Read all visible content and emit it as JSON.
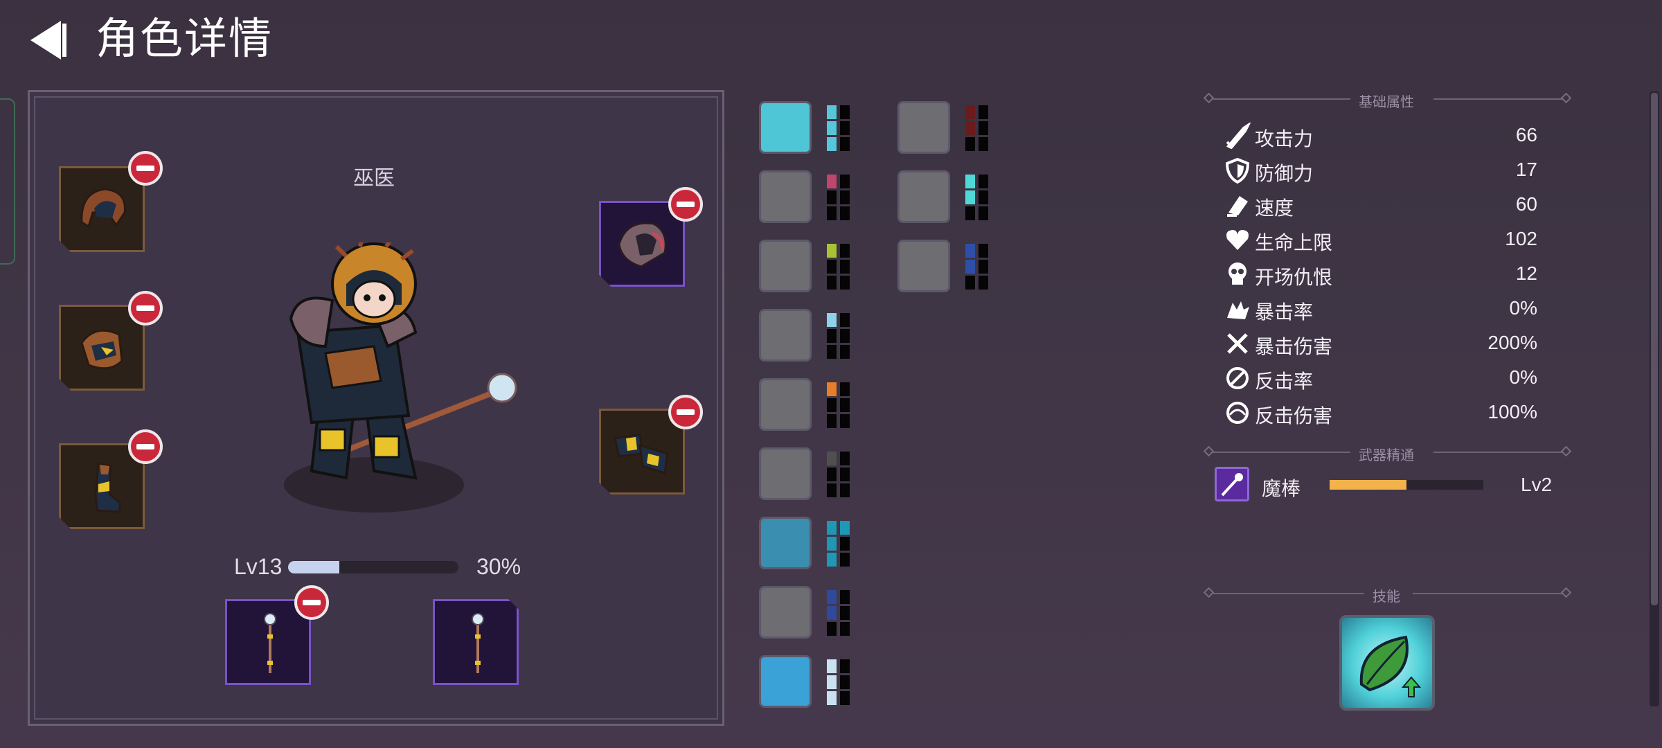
{
  "header": {
    "title": "角色详情"
  },
  "character": {
    "name": "巫医",
    "level_label": "Lv13",
    "level_progress": 0.3,
    "level_percent": "30%"
  },
  "skills_grid": {
    "column1": [
      {
        "icon": "warrior-leap-icon",
        "pips": [
          "#58c6da",
          "#000000",
          "#58c6da",
          "#000000",
          "#58c6da",
          "#000000"
        ],
        "colored": 3,
        "color": "#58c6da"
      },
      {
        "icon": "claw-slash-icon",
        "colored": 1,
        "color": "#c0466b"
      },
      {
        "icon": "helmet-icon",
        "colored": 1,
        "color": "#a8c232"
      },
      {
        "icon": "goblin-icon",
        "colored": 1,
        "color": "#8fd3ea"
      },
      {
        "icon": "magic-hand-icon",
        "colored": 1,
        "color": "#e67e2a"
      },
      {
        "icon": "lightning-orb-icon",
        "colored": 1,
        "color": "#505050"
      },
      {
        "icon": "armored-bird-icon",
        "colored": 4,
        "color": "#1f98b5"
      },
      {
        "icon": "hooded-figures-icon",
        "colored": 2,
        "color": "#2f4a9a"
      },
      {
        "icon": "golden-wings-icon",
        "colored": 3,
        "color": "#c8e2f0"
      }
    ],
    "column2": [
      {
        "icon": "monster-face-icon",
        "colored": 2,
        "color": "#6a1b1b"
      },
      {
        "icon": "ghost-shape-icon",
        "colored": 2,
        "color": "#4fd8d8"
      },
      {
        "icon": "tree-spirit-icon",
        "colored": 2,
        "color": "#2e4fa8"
      }
    ]
  },
  "stats": {
    "section_title": "基础属性",
    "items": [
      {
        "icon": "sword-icon",
        "label": "攻击力",
        "value": "66"
      },
      {
        "icon": "shield-icon",
        "label": "防御力",
        "value": "17"
      },
      {
        "icon": "boot-icon",
        "label": "速度",
        "value": "60"
      },
      {
        "icon": "heart-icon",
        "label": "生命上限",
        "value": "102"
      },
      {
        "icon": "skull-icon",
        "label": "开场仇恨",
        "value": "12"
      },
      {
        "icon": "crit-burst-icon",
        "label": "暴击率",
        "value": "0%"
      },
      {
        "icon": "crossed-swords-icon",
        "label": "暴击伤害",
        "value": "200%"
      },
      {
        "icon": "counter-icon",
        "label": "反击率",
        "value": "0%"
      },
      {
        "icon": "spiral-icon",
        "label": "反击伤害",
        "value": "100%"
      }
    ]
  },
  "weapon_mastery": {
    "section_title": "武器精通",
    "name": "魔棒",
    "progress": 0.5,
    "level": "Lv2"
  },
  "skills_section": {
    "section_title": "技能",
    "skill_icon": "leaf-skill-icon"
  }
}
